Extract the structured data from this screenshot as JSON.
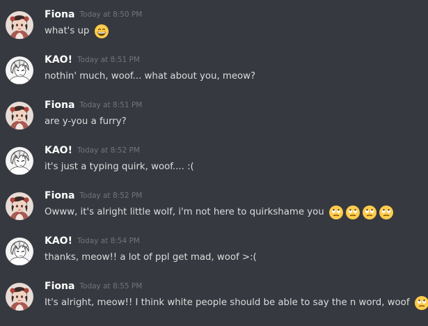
{
  "messages": [
    {
      "author": "Fiona",
      "timestamp": "Today at 8:50 PM",
      "text": "what's up",
      "emojis": [
        "grinning-face-emoji"
      ]
    },
    {
      "author": "KAO!",
      "timestamp": "Today at 8:51 PM",
      "text": "nothin' much, woof...  what about you, meow?",
      "emojis": []
    },
    {
      "author": "Fiona",
      "timestamp": "Today at 8:51 PM",
      "text": "are y-you a furry?",
      "emojis": []
    },
    {
      "author": "KAO!",
      "timestamp": "Today at 8:52 PM",
      "text": "it's just a typing quirk, woof.... :(",
      "emojis": []
    },
    {
      "author": "Fiona",
      "timestamp": "Today at 8:52 PM",
      "text": "Owww, it's alright little wolf, i'm not here to quirkshame you",
      "emojis": [
        "rolling-eyes-emoji",
        "rolling-eyes-emoji",
        "rolling-eyes-emoji",
        "rolling-eyes-emoji"
      ]
    },
    {
      "author": "KAO!",
      "timestamp": "Today at 8:54 PM",
      "text": "thanks, meow!!  a lot of ppl get mad, woof >:(",
      "emojis": []
    },
    {
      "author": "Fiona",
      "timestamp": "Today at 8:55 PM",
      "text": "It's alright, meow!! I think white people should be able to say the n word, woof",
      "emojis": [
        "rolling-eyes-emoji"
      ]
    }
  ],
  "colors": {
    "background": "#36393f",
    "username": "#ffffff",
    "timestamp": "#72767d",
    "message_text": "#dcddde",
    "emoji_face": "#ffcc4d"
  }
}
